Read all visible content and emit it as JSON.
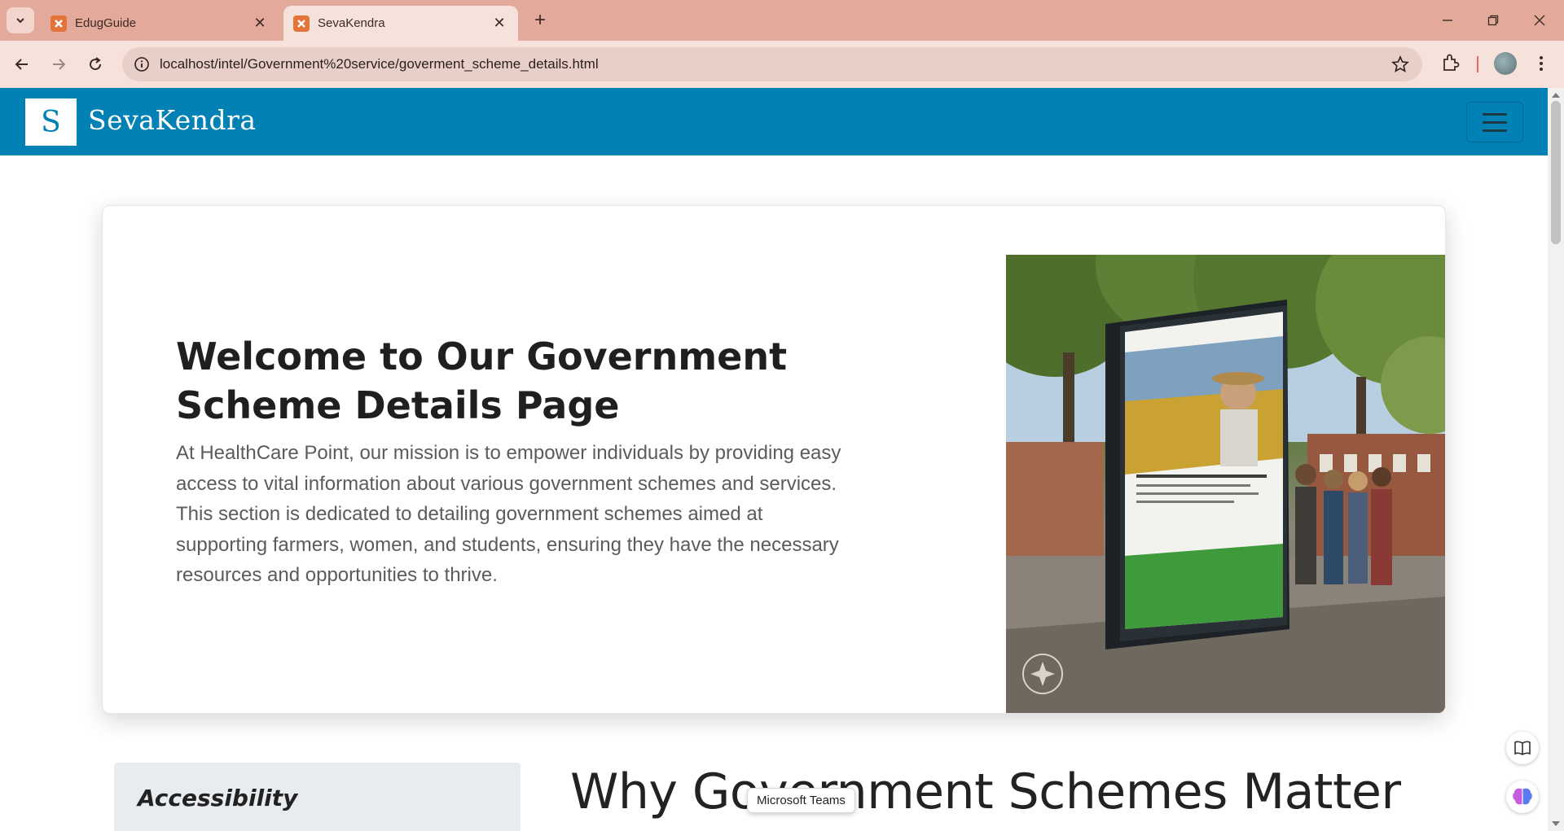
{
  "browser": {
    "tabs": [
      {
        "title": "EdugGuide",
        "active": false
      },
      {
        "title": "SevaKendra",
        "active": true
      }
    ],
    "url": "localhost/intel/Government%20service/goverment_scheme_details.html"
  },
  "site": {
    "logo_letter": "S",
    "brand": "SevaKendra"
  },
  "hero": {
    "title": "Welcome to Our Government Scheme Details Page",
    "text": "At HealthCare Point, our mission is to empower individuals by providing easy access to vital information about various government schemes and services. This section is dedicated to detailing government schemes aimed at supporting farmers, women, and students, ensuring they have the necessary resources and opportunities to thrive."
  },
  "sidebar": {
    "title": "Accessibility"
  },
  "section": {
    "heading": "Why Government Schemes Matter"
  },
  "tooltip": {
    "text": "Microsoft Teams"
  },
  "colors": {
    "tabbar": "#e3a99a",
    "toolbar": "#f6e1db",
    "navbar": "#0281b4"
  }
}
